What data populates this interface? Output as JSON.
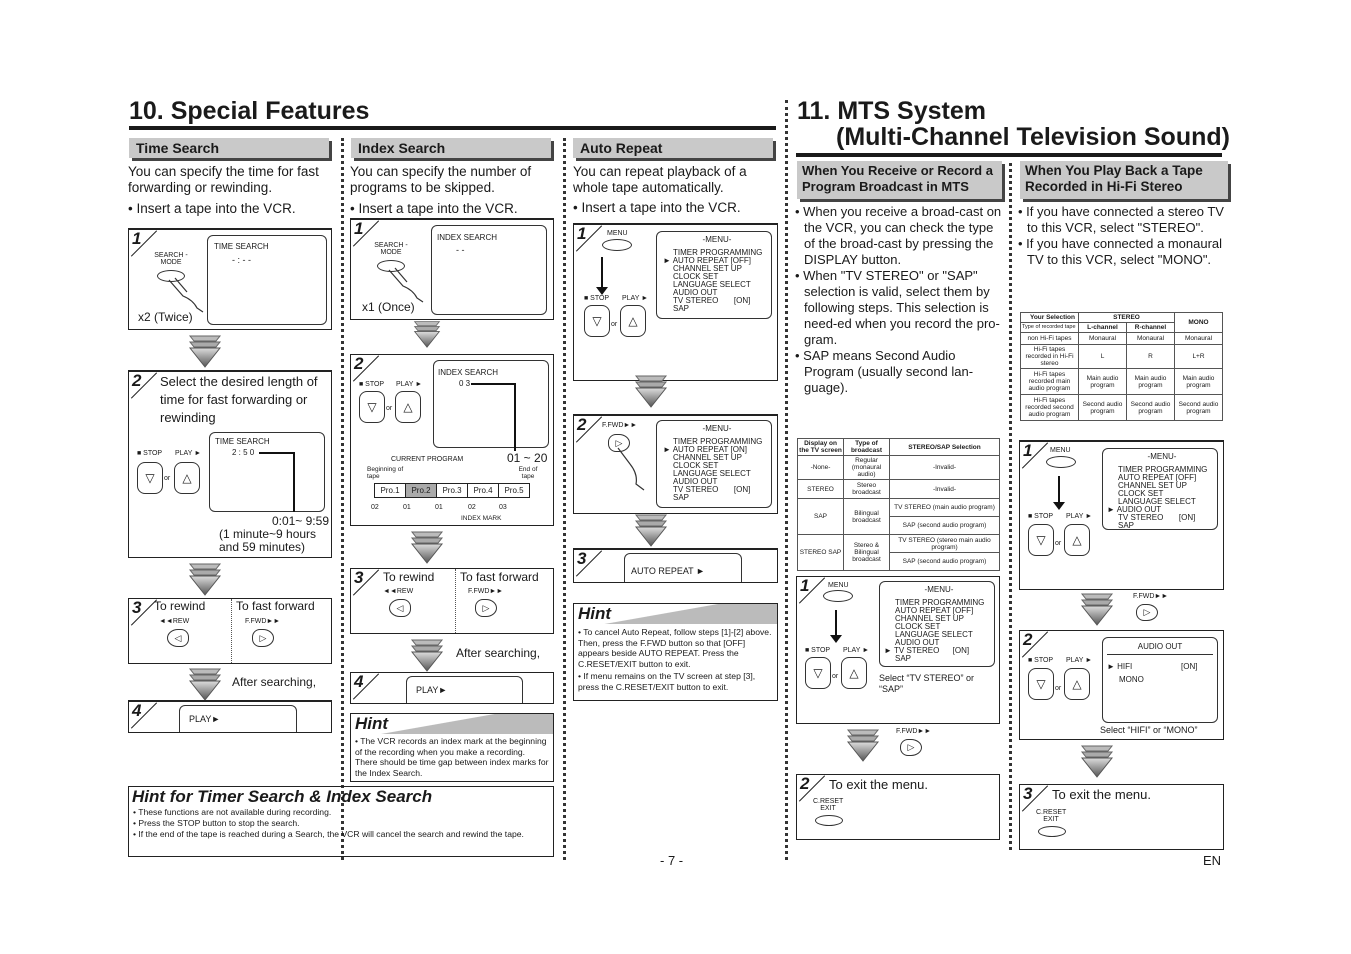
{
  "page": {
    "number": "- 7 -",
    "lang": "EN"
  },
  "left": {
    "title": "10. Special Features",
    "time_search": {
      "heading": "Time Search",
      "intro": "You can specify the time for fast forwarding or rewinding.",
      "bullet": "• Insert a tape into the VCR.",
      "step1": {
        "num": "1",
        "button": "SEARCH -MODE",
        "screen_title": "TIME SEARCH",
        "screen_value": "- : - -",
        "caption": "x2 (Twice)"
      },
      "step2": {
        "num": "2",
        "text": "Select the desired length of time for fast forwarding or rewinding",
        "stop": "■ STOP",
        "play": "PLAY ►",
        "or": "or",
        "screen_title": "TIME SEARCH",
        "screen_value": "2 : 5 0",
        "range": "0:01~ 9:59",
        "range_note": "(1 minute~9 hours and 59 minutes)"
      },
      "step3": {
        "num": "3",
        "rewind": "To rewind",
        "rew_btn": "◄◄REW",
        "ffwd": "To fast forward",
        "ffwd_btn": "F.FWD►►"
      },
      "after": "After searching,",
      "step4": {
        "num": "4",
        "screen": "PLAY►"
      }
    },
    "index_search": {
      "heading": "Index Search",
      "intro": "You can specify the number of programs to be skipped.",
      "bullet": "• Insert a tape into the VCR.",
      "step1": {
        "num": "1",
        "button": "SEARCH -MODE",
        "screen_title": "INDEX SEARCH",
        "screen_value": "- -",
        "caption": "x1 (Once)"
      },
      "step2": {
        "num": "2",
        "stop": "■ STOP",
        "play": "PLAY ►",
        "or": "or",
        "screen_title": "INDEX SEARCH",
        "screen_value": "0 3",
        "range": "01 ~ 20",
        "current": "CURRENT PROGRAM",
        "begin": "Beginning of tape",
        "end": "End of tape",
        "programs": [
          "Pro.1",
          "Pro.2",
          "Pro.3",
          "Pro.4",
          "Pro.5"
        ],
        "marks": [
          "02",
          "01",
          "01",
          "02",
          "03"
        ],
        "index_mark": "INDEX MARK"
      },
      "step3": {
        "num": "3",
        "rewind": "To rewind",
        "rew_btn": "◄◄REW",
        "ffwd": "To fast forward",
        "ffwd_btn": "F.FWD►►"
      },
      "after": "After searching,",
      "step4": {
        "num": "4",
        "screen": "PLAY►"
      },
      "hint": {
        "title": "Hint",
        "items": [
          "• The VCR records an index mark at the beginning of the recording when you make a recording. There should be time gap between index marks for the Index Search."
        ]
      }
    },
    "auto_repeat": {
      "heading": "Auto Repeat",
      "intro": "You can repeat playback of a whole tape automatically.",
      "bullet": "• Insert a tape into the VCR.",
      "step1": {
        "num": "1",
        "menu_btn": "MENU",
        "stop": "■ STOP",
        "play": "PLAY ►",
        "or": "or",
        "menu": [
          "-MENU-",
          "TIMER PROGRAMMING",
          "► AUTO REPEAT  [OFF]",
          "CHANNEL SET UP",
          "CLOCK SET",
          "LANGUAGE SELECT",
          "AUDIO OUT",
          "TV STEREO       [ON]",
          "SAP"
        ]
      },
      "step2": {
        "num": "2",
        "ffwd_btn": "F.FWD►►",
        "menu": [
          "-MENU-",
          "TIMER PROGRAMMING",
          "► AUTO REPEAT  [ON]",
          "CHANNEL SET UP",
          "CLOCK SET",
          "LANGUAGE SELECT",
          "AUDIO OUT",
          "TV STEREO       [ON]",
          "SAP"
        ]
      },
      "step3": {
        "num": "3",
        "screen": "AUTO REPEAT ►"
      },
      "hint": {
        "title": "Hint",
        "items": [
          "• To cancel Auto Repeat, follow steps [1]-[2] above.  Then, press the F.FWD button so that [OFF] appears beside AUTO REPEAT. Press the C.RESET/EXIT button to exit.",
          "• If menu remains on the TV screen at step [3], press the C.RESET/EXIT button to exit."
        ]
      }
    },
    "bottom_hint": {
      "title": "Hint for Timer Search & Index Search",
      "items": [
        "• These functions are not available during recording.",
        "• Press the STOP button to stop the search.",
        "• If the end of the tape is reached during a Search, the VCR will cancel the search and rewind the tape."
      ]
    }
  },
  "right": {
    "title_line1": "11. MTS System",
    "title_line2": "(Multi-Channel Television Sound)",
    "receive": {
      "heading": "When You Receive or Record a Program Broadcast in MTS",
      "bullets": [
        "• When you receive a broad-cast on the VCR, you can check the type of the broad-cast by pressing the DISPLAY button.",
        "• When \"TV STEREO\" or \"SAP\" selection is valid, select them by following steps. This selection is need-ed when you record the pro-gram.",
        "• SAP means Second Audio Program (usually second lan-guage)."
      ],
      "table": {
        "headers": [
          "Display on the TV screen",
          "Type of broadcast",
          "STEREO/SAP Selection"
        ],
        "rows": [
          [
            "-None-",
            "Regular (monaural audio)",
            "-Invalid-"
          ],
          [
            "STEREO",
            "Stereo broadcast",
            "-Invalid-"
          ],
          [
            "SAP",
            "Bilingual broadcast",
            "TV STEREO (main audio program)",
            "SAP (second audio program)"
          ],
          [
            "STEREO SAP",
            "Stereo & Bilingual broadcast",
            "TV STEREO (stereo main audio program)",
            "SAP (second audio program)"
          ]
        ]
      },
      "step1": {
        "num": "1",
        "menu_btn": "MENU",
        "stop": "■ STOP",
        "play": "PLAY ►",
        "or": "or",
        "caption": "Select “TV STEREO” or “SAP”",
        "menu": [
          "-MENU-",
          "TIMER PROGRAMMING",
          "AUTO REPEAT  [OFF]",
          "CHANNEL SET UP",
          "CLOCK SET",
          "LANGUAGE SELECT",
          "AUDIO OUT",
          "► TV STEREO      [ON]",
          "SAP"
        ]
      },
      "ffwd_btn": "F.FWD►►",
      "step2": {
        "num": "2",
        "text": "To exit the menu.",
        "button": "C.RESET EXIT"
      }
    },
    "playback": {
      "heading": "When You Play Back a Tape Recorded in Hi-Fi Stereo",
      "bullets": [
        "• If you have connected a stereo TV to this VCR, select \"STEREO\".",
        "• If you have connected a monaural TV to this VCR, select \"MONO\"."
      ],
      "table": {
        "corner_top": "Your Selection",
        "corner_bottom": "Type of recorded tape",
        "group": "STEREO",
        "cols": [
          "L-channel",
          "R-channel",
          "MONO"
        ],
        "rows": [
          [
            "non Hi-Fi tapes",
            "Monaural",
            "Monaural",
            "Monaural"
          ],
          [
            "Hi-Fi tapes recorded in Hi-Fi stereo",
            "L",
            "R",
            "L+R"
          ],
          [
            "Hi-Fi tapes recorded main audio program",
            "Main audio program",
            "Main audio program",
            "Main audio program"
          ],
          [
            "Hi-Fi tapes recorded second audio program",
            "Second audio program",
            "Second audio program",
            "Second audio program"
          ]
        ]
      },
      "step1": {
        "num": "1",
        "menu_btn": "MENU",
        "stop": "■ STOP",
        "play": "PLAY ►",
        "or": "or",
        "menu": [
          "-MENU-",
          "TIMER PROGRAMMING",
          "AUTO REPEAT  [OFF]",
          "CHANNEL SET UP",
          "CLOCK SET",
          "LANGUAGE SELECT",
          "► AUDIO OUT",
          "TV STEREO       [ON]",
          "SAP"
        ]
      },
      "ffwd_btn": "F.FWD►►",
      "step2": {
        "num": "2",
        "stop": "■ STOP",
        "play": "PLAY ►",
        "or": "or",
        "screen_title": "AUDIO OUT",
        "opt1": "► HIFI",
        "opt1_val": "[ON]",
        "opt2": "MONO",
        "caption": "Select “HIFI” or “MONO”"
      },
      "step3": {
        "num": "3",
        "text": "To exit the menu.",
        "button": "C.RESET EXIT"
      }
    }
  }
}
